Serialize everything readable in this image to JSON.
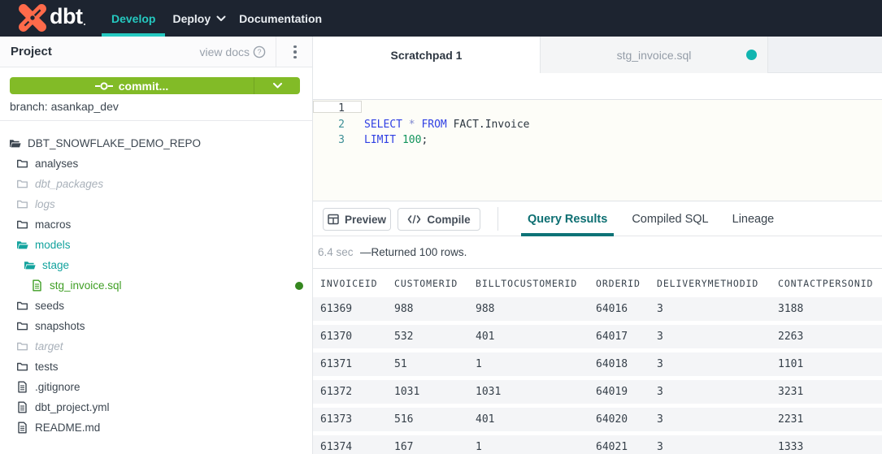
{
  "navbar": {
    "logo_text": "dbt",
    "items": [
      {
        "label": "Develop",
        "active": true,
        "dropdown": false
      },
      {
        "label": "Deploy",
        "active": false,
        "dropdown": true
      },
      {
        "label": "Documentation",
        "active": false,
        "dropdown": false
      }
    ]
  },
  "sidebar": {
    "title": "Project",
    "view_docs_label": "view docs",
    "commit_label": "commit...",
    "branch_label": "branch: asankap_dev",
    "tree": [
      {
        "label": "DBT_SNOWFLAKE_DEMO_REPO",
        "depth": 0,
        "icon": "folder-open",
        "style": "normal"
      },
      {
        "label": "analyses",
        "depth": 1,
        "icon": "folder",
        "style": "normal"
      },
      {
        "label": "dbt_packages",
        "depth": 1,
        "icon": "folder",
        "style": "muted"
      },
      {
        "label": "logs",
        "depth": 1,
        "icon": "folder",
        "style": "muted"
      },
      {
        "label": "macros",
        "depth": 1,
        "icon": "folder",
        "style": "normal"
      },
      {
        "label": "models",
        "depth": 1,
        "icon": "folder-open",
        "style": "teal"
      },
      {
        "label": "stage",
        "depth": 2,
        "icon": "folder-open",
        "style": "teal"
      },
      {
        "label": "stg_invoice.sql",
        "depth": 3,
        "icon": "file",
        "style": "green",
        "modified": true
      },
      {
        "label": "seeds",
        "depth": 1,
        "icon": "folder",
        "style": "normal"
      },
      {
        "label": "snapshots",
        "depth": 1,
        "icon": "folder",
        "style": "normal"
      },
      {
        "label": "target",
        "depth": 1,
        "icon": "folder",
        "style": "muted"
      },
      {
        "label": "tests",
        "depth": 1,
        "icon": "folder",
        "style": "normal"
      },
      {
        "label": ".gitignore",
        "depth": 1,
        "icon": "file",
        "style": "normal"
      },
      {
        "label": "dbt_project.yml",
        "depth": 1,
        "icon": "file",
        "style": "normal"
      },
      {
        "label": "README.md",
        "depth": 1,
        "icon": "file",
        "style": "normal"
      }
    ]
  },
  "editor": {
    "tabs": [
      {
        "label": "Scratchpad 1",
        "active": true,
        "modified": false
      },
      {
        "label": "stg_invoice.sql",
        "active": false,
        "modified": true
      }
    ],
    "lines": [
      {
        "number": "1",
        "current": true,
        "tokens": []
      },
      {
        "number": "2",
        "current": false,
        "tokens": [
          {
            "text": "SELECT",
            "type": "kw"
          },
          {
            "text": " ",
            "type": "plain"
          },
          {
            "text": "*",
            "type": "op"
          },
          {
            "text": " ",
            "type": "plain"
          },
          {
            "text": "FROM",
            "type": "kw"
          },
          {
            "text": " FACT.Invoice",
            "type": "plain"
          }
        ]
      },
      {
        "number": "3",
        "current": false,
        "tokens": [
          {
            "text": "LIMIT",
            "type": "kw"
          },
          {
            "text": " ",
            "type": "plain"
          },
          {
            "text": "100",
            "type": "num"
          },
          {
            "text": ";",
            "type": "plain"
          }
        ]
      }
    ]
  },
  "results": {
    "buttons": [
      {
        "label": "Preview",
        "icon": "table-icon"
      },
      {
        "label": "Compile",
        "icon": "code-icon"
      }
    ],
    "tabs": [
      {
        "label": "Query Results",
        "active": true
      },
      {
        "label": "Compiled SQL",
        "active": false
      },
      {
        "label": "Lineage",
        "active": false
      }
    ],
    "status_time": "6.4 sec",
    "status_message": "—Returned 100 rows.",
    "table": {
      "columns": [
        "INVOICEID",
        "CUSTOMERID",
        "BILLTOCUSTOMERID",
        "ORDERID",
        "DELIVERYMETHODID",
        "CONTACTPERSONID"
      ],
      "rows": [
        [
          "61369",
          "988",
          "988",
          "64016",
          "3",
          "3188"
        ],
        [
          "61370",
          "532",
          "401",
          "64017",
          "3",
          "2263"
        ],
        [
          "61371",
          "51",
          "1",
          "64018",
          "3",
          "1101"
        ],
        [
          "61372",
          "1031",
          "1031",
          "64019",
          "3",
          "3231"
        ],
        [
          "61373",
          "516",
          "401",
          "64020",
          "3",
          "2231"
        ],
        [
          "61374",
          "167",
          "1",
          "64021",
          "3",
          "1333"
        ]
      ]
    }
  },
  "colors": {
    "navbar_bg": "#1d2430",
    "accent_teal": "#25c9c0",
    "results_teal": "#0d7377",
    "commit_green": "#82bb27",
    "file_green": "#3f9e24",
    "logo_orange": "#ff6a4a"
  }
}
